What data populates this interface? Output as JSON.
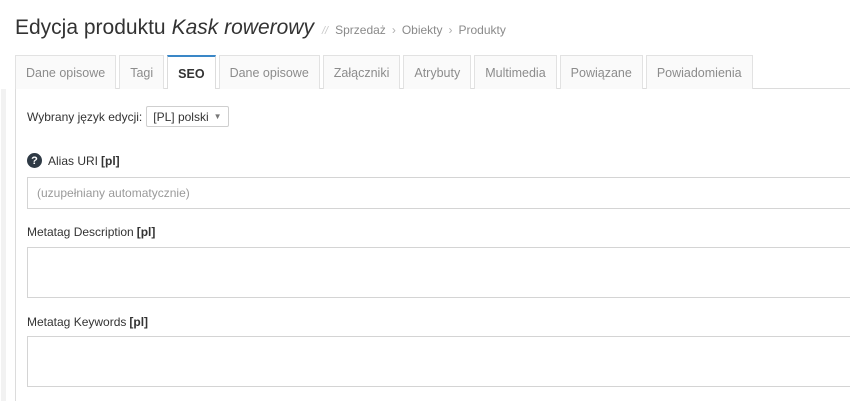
{
  "header": {
    "title_prefix": "Edycja produktu",
    "product_name": "Kask rowerowy",
    "separator": "//",
    "breadcrumb": [
      "Sprzedaż",
      "Obiekty",
      "Produkty"
    ],
    "breadcrumb_chevron": "›"
  },
  "tabs": [
    {
      "label": "Dane opisowe",
      "active": false
    },
    {
      "label": "Tagi",
      "active": false
    },
    {
      "label": "SEO",
      "active": true
    },
    {
      "label": "Dane opisowe",
      "active": false
    },
    {
      "label": "Załączniki",
      "active": false
    },
    {
      "label": "Atrybuty",
      "active": false
    },
    {
      "label": "Multimedia",
      "active": false
    },
    {
      "label": "Powiązane",
      "active": false
    },
    {
      "label": "Powiadomienia",
      "active": false
    }
  ],
  "form": {
    "language_label": "Wybrany język edycji:",
    "language_value": "[PL] polski",
    "alias": {
      "label": "Alias URI",
      "lang_tag": "[pl]",
      "help_icon": "question-circle-icon",
      "placeholder": "(uzupełniany automatycznie)",
      "value": ""
    },
    "description": {
      "label": "Metatag Description",
      "lang_tag": "[pl]",
      "value": ""
    },
    "keywords": {
      "label": "Metatag Keywords",
      "lang_tag": "[pl]",
      "value": ""
    }
  },
  "colors": {
    "active_tab_accent": "#3a87c7",
    "help_icon_bg": "#2f3a45"
  }
}
